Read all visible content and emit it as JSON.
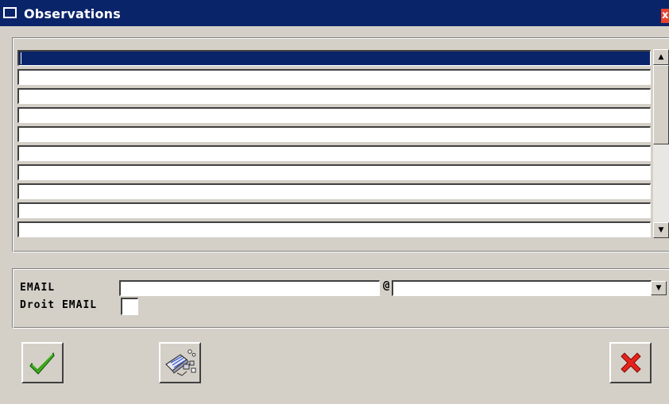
{
  "window": {
    "title": "Observations",
    "close_glyph": "x"
  },
  "list": {
    "row_count": 10,
    "selected_row": 0
  },
  "email": {
    "label": "EMAIL",
    "user_value": "",
    "at_sign": "@",
    "domain_value": ""
  },
  "droit_email": {
    "label": "Droit EMAIL",
    "checked": false
  },
  "buttons": {
    "ok_icon": "check-icon",
    "tool_icon": "eraser-icon",
    "cancel_icon": "close-icon"
  },
  "colors": {
    "titlebar": "#0a246a",
    "selection": "#0a246a",
    "ok_check": "#3fae1f",
    "cancel_x": "#e8221b"
  }
}
